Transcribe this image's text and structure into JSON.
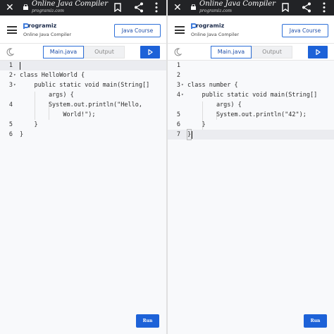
{
  "browser": {
    "title": "Online Java Compiler",
    "url": "programiz.com"
  },
  "app": {
    "brand": "rogramiz",
    "subtitle": "Online Java Compiler",
    "course_button": "Java Course"
  },
  "tabs": {
    "main": "Main.java",
    "output": "Output"
  },
  "run_label": "Run",
  "colors": {
    "accent": "#1d62d8",
    "browser_bar": "#222326"
  },
  "left_editor": {
    "lines": [
      {
        "num": "1",
        "text": ""
      },
      {
        "num": "2",
        "text": "class HelloWorld {"
      },
      {
        "num": "3",
        "text": "    public static void main(String[]"
      },
      {
        "num": "",
        "text": "        args) {"
      },
      {
        "num": "4",
        "text": "        System.out.println(\"Hello,"
      },
      {
        "num": "",
        "text": "            World!\");"
      },
      {
        "num": "5",
        "text": "    }"
      },
      {
        "num": "6",
        "text": "}"
      }
    ]
  },
  "right_editor": {
    "lines": [
      {
        "num": "1",
        "text": ""
      },
      {
        "num": "2",
        "text": ""
      },
      {
        "num": "3",
        "text": "class number {"
      },
      {
        "num": "4",
        "text": "    public static void main(String[]"
      },
      {
        "num": "",
        "text": "        args) {"
      },
      {
        "num": "5",
        "text": "        System.out.println(\"42\");"
      },
      {
        "num": "6",
        "text": "    }"
      },
      {
        "num": "7",
        "text": "}"
      }
    ]
  }
}
